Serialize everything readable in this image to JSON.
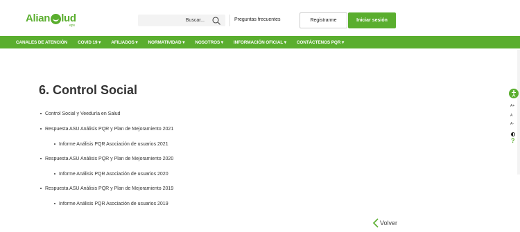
{
  "header": {
    "logo_text_left": "Alian",
    "logo_text_right": "lud",
    "logo_sub": "eps",
    "search_placeholder": "Buscar...",
    "faq_label": "Preguntas frecuentes",
    "register_label": "Registrarme",
    "login_label": "Iniciar sesión"
  },
  "nav": {
    "items": [
      "CANALES DE ATENCIÓN",
      "COVID 19 ▾",
      "AFILIADOS ▾",
      "NORMATIVIDAD ▾",
      "NOSOTROS ▾",
      "INFORMACIÓN OFICIAL ▾",
      "CONTÁCTENOS PQR ▾"
    ]
  },
  "main": {
    "title": "6. Control Social",
    "items": [
      {
        "text": "Control Social y Veeduría en Salud",
        "level": 1
      },
      {
        "text": "Respuesta ASU Análisis PQR y Plan de Mejoramiento 2021",
        "level": 1
      },
      {
        "text": "Informe Análisis PQR Asociación de usuarios 2021",
        "level": 2
      },
      {
        "text": "Respuesta ASU Análisis PQR y Plan de Mejoramiento 2020",
        "level": 1
      },
      {
        "text": "Informe Análisis PQR Asociación de usuarios 2020",
        "level": 2
      },
      {
        "text": "Respuesta ASU Análisis PQR y Plan de Mejoramiento 2019",
        "level": 1
      },
      {
        "text": "Informe Análisis PQR Asociación de usuarios 2019",
        "level": 2
      }
    ],
    "back_label": "Volver"
  },
  "accessibility": {
    "font_up": "A+",
    "font_reset": "A",
    "font_down": "A-",
    "help": "?"
  },
  "colors": {
    "brand_green": "#5aae2e",
    "text": "#333333"
  }
}
